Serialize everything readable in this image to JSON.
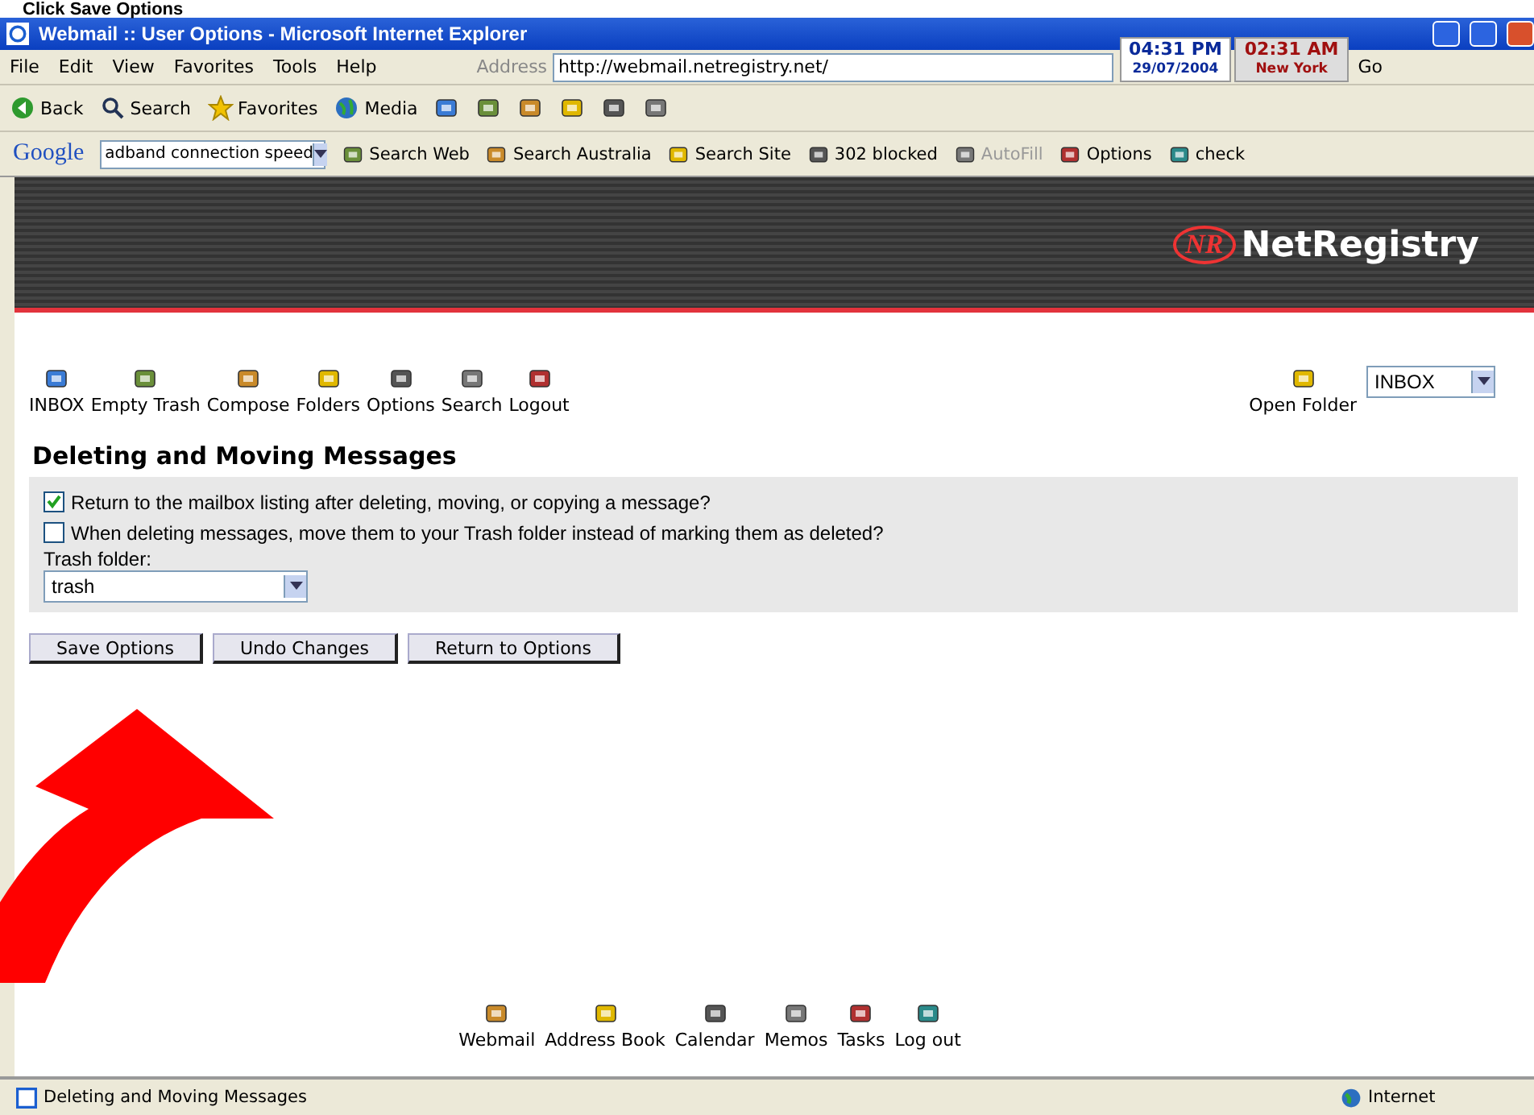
{
  "caption": "Click Save Options",
  "window": {
    "title": "Webmail :: User Options - Microsoft Internet Explorer"
  },
  "menu": [
    "File",
    "Edit",
    "View",
    "Favorites",
    "Tools",
    "Help"
  ],
  "address": {
    "label": "Address",
    "url": "http://webmail.netregistry.net/",
    "go": "Go"
  },
  "clocks": [
    {
      "time": "04:31 PM",
      "place": "29/07/2004"
    },
    {
      "time": "02:31 AM",
      "place": "New York"
    }
  ],
  "toolbar": [
    {
      "label": "Back",
      "kind": "back"
    },
    {
      "label": "Search",
      "kind": "search"
    },
    {
      "label": "Favorites",
      "kind": "favorites"
    },
    {
      "label": "Media",
      "kind": "media"
    }
  ],
  "google_bar": {
    "logo": "Google",
    "query": "adband connection speed",
    "items": [
      {
        "label": "Search Web",
        "disabled": false
      },
      {
        "label": "Search Australia",
        "disabled": false
      },
      {
        "label": "Search Site",
        "disabled": false
      },
      {
        "label": "302 blocked",
        "disabled": false
      },
      {
        "label": "AutoFill",
        "disabled": true
      },
      {
        "label": "Options",
        "disabled": false
      },
      {
        "label": "check",
        "disabled": false
      }
    ]
  },
  "banner": {
    "brand": "NetRegistry",
    "badge": "NR"
  },
  "nav": [
    "INBOX",
    "Empty Trash",
    "Compose",
    "Folders",
    "Options",
    "Search",
    "Logout"
  ],
  "open_folder": {
    "label": "Open Folder",
    "value": "INBOX"
  },
  "section": {
    "heading": "Deleting and Moving Messages",
    "options": [
      {
        "label": "Return to the mailbox listing after deleting, moving, or copying a message?",
        "checked": true
      },
      {
        "label": "When deleting messages, move them to your Trash folder instead of marking them as deleted?",
        "checked": false
      }
    ],
    "trash_label": "Trash folder:",
    "trash_value": "trash"
  },
  "buttons": [
    "Save Options",
    "Undo Changes",
    "Return to Options"
  ],
  "footer_nav": [
    "Webmail",
    "Address Book",
    "Calendar",
    "Memos",
    "Tasks",
    "Log out"
  ],
  "status_bar": {
    "text": "Deleting and Moving Messages",
    "zone": "Internet"
  }
}
